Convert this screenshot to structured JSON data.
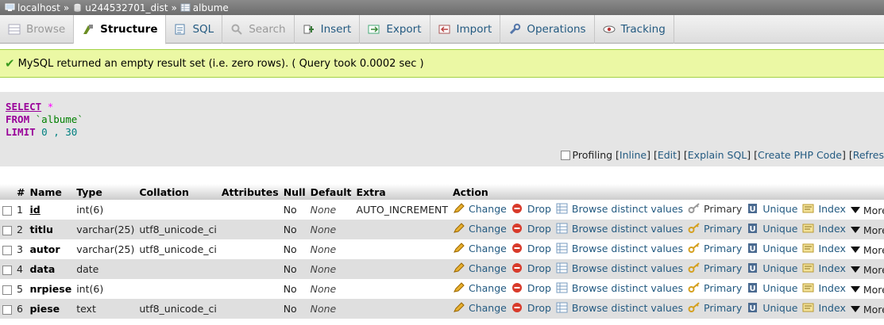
{
  "breadcrumb": [
    {
      "label": "localhost",
      "icon": "server-icon"
    },
    {
      "label": "u244532701_dist",
      "icon": "database-icon"
    },
    {
      "label": "albume",
      "icon": "table-icon"
    }
  ],
  "breadcrumb_separator": "»",
  "tabs": [
    {
      "label": "Browse",
      "icon": "browse-icon",
      "state": "disabled"
    },
    {
      "label": "Structure",
      "icon": "structure-icon",
      "state": "active"
    },
    {
      "label": "SQL",
      "icon": "sql-icon",
      "state": "normal"
    },
    {
      "label": "Search",
      "icon": "search-icon",
      "state": "disabled"
    },
    {
      "label": "Insert",
      "icon": "insert-icon",
      "state": "normal"
    },
    {
      "label": "Export",
      "icon": "export-icon",
      "state": "normal"
    },
    {
      "label": "Import",
      "icon": "import-icon",
      "state": "normal"
    },
    {
      "label": "Operations",
      "icon": "wrench-icon",
      "state": "normal"
    },
    {
      "label": "Tracking",
      "icon": "eye-icon",
      "state": "normal"
    }
  ],
  "success_message": "MySQL returned an empty result set (i.e. zero rows). ( Query took 0.0002 sec )",
  "sql": {
    "select": "SELECT",
    "star": "*",
    "from": "FROM",
    "table": "`albume`",
    "limit": "LIMIT",
    "limit_args": "0 , 30"
  },
  "sql_links": {
    "profiling": "Profiling",
    "inline": "Inline",
    "edit": "Edit",
    "explain": "Explain SQL",
    "create_php": "Create PHP Code",
    "refresh": "Refres"
  },
  "columns": [
    "#",
    "Name",
    "Type",
    "Collation",
    "Attributes",
    "Null",
    "Default",
    "Extra",
    "Action"
  ],
  "actions": {
    "change": "Change",
    "drop": "Drop",
    "browse_distinct": "Browse distinct values",
    "primary": "Primary",
    "unique": "Unique",
    "index": "Index",
    "more": "More"
  },
  "rows": [
    {
      "num": "1",
      "name": "id",
      "type": "int(6)",
      "collation": "",
      "attributes": "",
      "null": "No",
      "default": "None",
      "extra": "AUTO_INCREMENT",
      "primary_key": true
    },
    {
      "num": "2",
      "name": "titlu",
      "type": "varchar(25)",
      "collation": "utf8_unicode_ci",
      "attributes": "",
      "null": "No",
      "default": "None",
      "extra": "",
      "primary_key": false
    },
    {
      "num": "3",
      "name": "autor",
      "type": "varchar(25)",
      "collation": "utf8_unicode_ci",
      "attributes": "",
      "null": "No",
      "default": "None",
      "extra": "",
      "primary_key": false
    },
    {
      "num": "4",
      "name": "data",
      "type": "date",
      "collation": "",
      "attributes": "",
      "null": "No",
      "default": "None",
      "extra": "",
      "primary_key": false
    },
    {
      "num": "5",
      "name": "nrpiese",
      "type": "int(6)",
      "collation": "",
      "attributes": "",
      "null": "No",
      "default": "None",
      "extra": "",
      "primary_key": false
    },
    {
      "num": "6",
      "name": "piese",
      "type": "text",
      "collation": "utf8_unicode_ci",
      "attributes": "",
      "null": "No",
      "default": "None",
      "extra": "",
      "primary_key": false
    }
  ],
  "colors": {
    "link": "#235a81",
    "success_bg": "#ebf8a4",
    "sql_keyword": "#990099",
    "sql_string": "#008000"
  }
}
